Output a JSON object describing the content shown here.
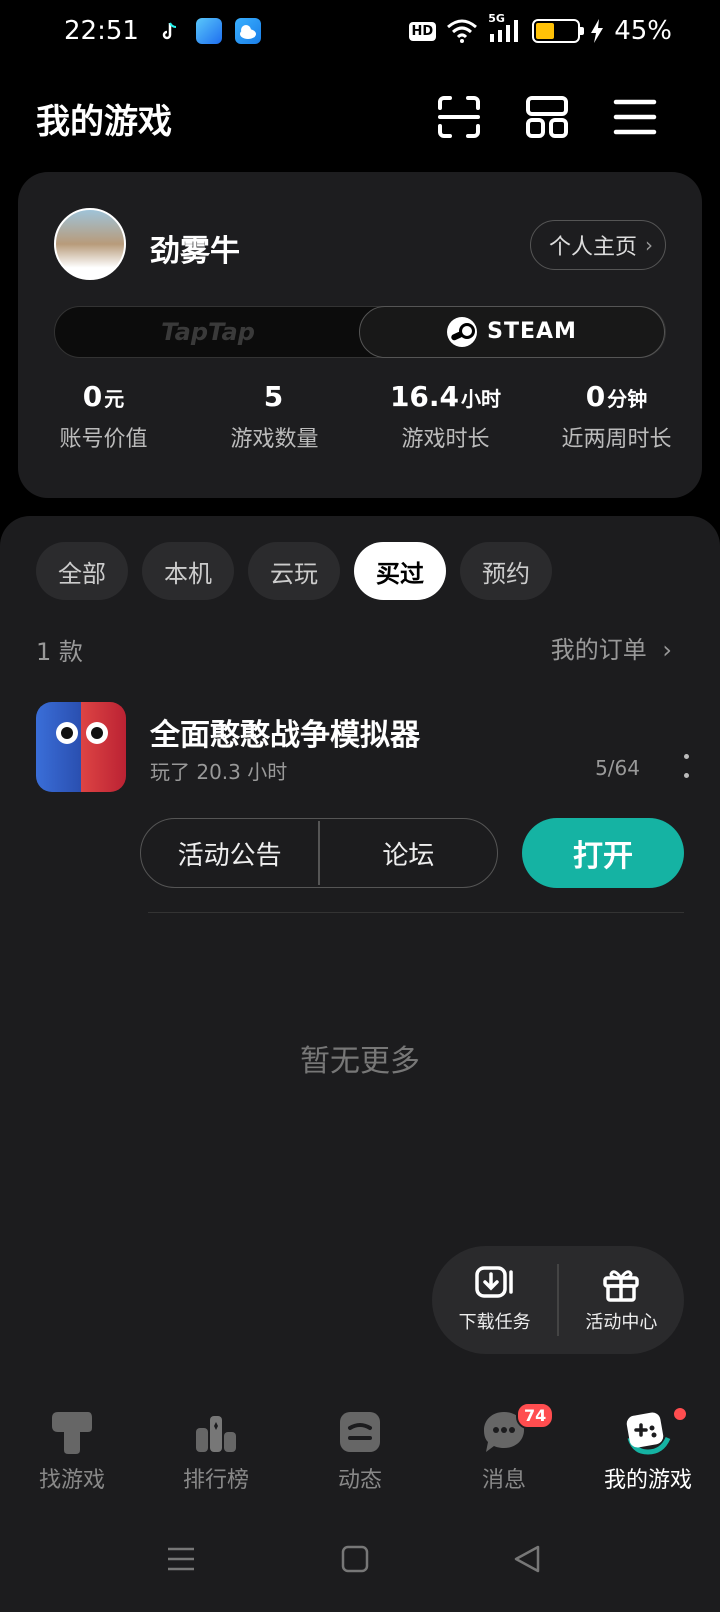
{
  "status_bar": {
    "time": "22:51",
    "hd_label": "HD",
    "network_label": "5G",
    "battery_percent_text": "45%",
    "battery_level": 0.45,
    "apps": [
      "tiktok-icon",
      "browser-icon",
      "weather-icon"
    ]
  },
  "header": {
    "title": "我的游戏",
    "icons": [
      "scan-icon",
      "grid-icon",
      "menu-icon"
    ]
  },
  "profile": {
    "username": "劲雾牛",
    "homepage_label": "个人主页",
    "platforms": {
      "taptap": "TapTap",
      "steam": "STEAM",
      "active": "steam"
    },
    "stats": [
      {
        "value": "0",
        "unit": "元",
        "label": "账号价值"
      },
      {
        "value": "5",
        "unit": "",
        "label": "游戏数量"
      },
      {
        "value": "16.4",
        "unit": "小时",
        "label": "游戏时长"
      },
      {
        "value": "0",
        "unit": "分钟",
        "label": "近两周时长"
      }
    ]
  },
  "filters": {
    "tabs": [
      "全部",
      "本机",
      "云玩",
      "买过",
      "预约"
    ],
    "active": "买过"
  },
  "list": {
    "count_text": "1 款",
    "orders_label": "我的订单"
  },
  "game": {
    "title": "全面憨憨战争模拟器",
    "playtime": "玩了 20.3 小时",
    "achievements": "5/64",
    "actions": {
      "announcement": "活动公告",
      "forum": "论坛",
      "open": "打开"
    }
  },
  "empty_text": "暂无更多",
  "float_bar": {
    "download": "下载任务",
    "activity": "活动中心"
  },
  "bottom_nav": {
    "items": [
      {
        "label": "找游戏",
        "icon": "taptap-icon"
      },
      {
        "label": "排行榜",
        "icon": "ranking-icon"
      },
      {
        "label": "动态",
        "icon": "feed-icon"
      },
      {
        "label": "消息",
        "icon": "message-icon",
        "badge": "74"
      },
      {
        "label": "我的游戏",
        "icon": "gamepad-icon"
      }
    ],
    "active": "我的游戏"
  },
  "colors": {
    "accent": "#15b3a3",
    "badge": "#ff4d4f",
    "battery": "#ffc107"
  }
}
